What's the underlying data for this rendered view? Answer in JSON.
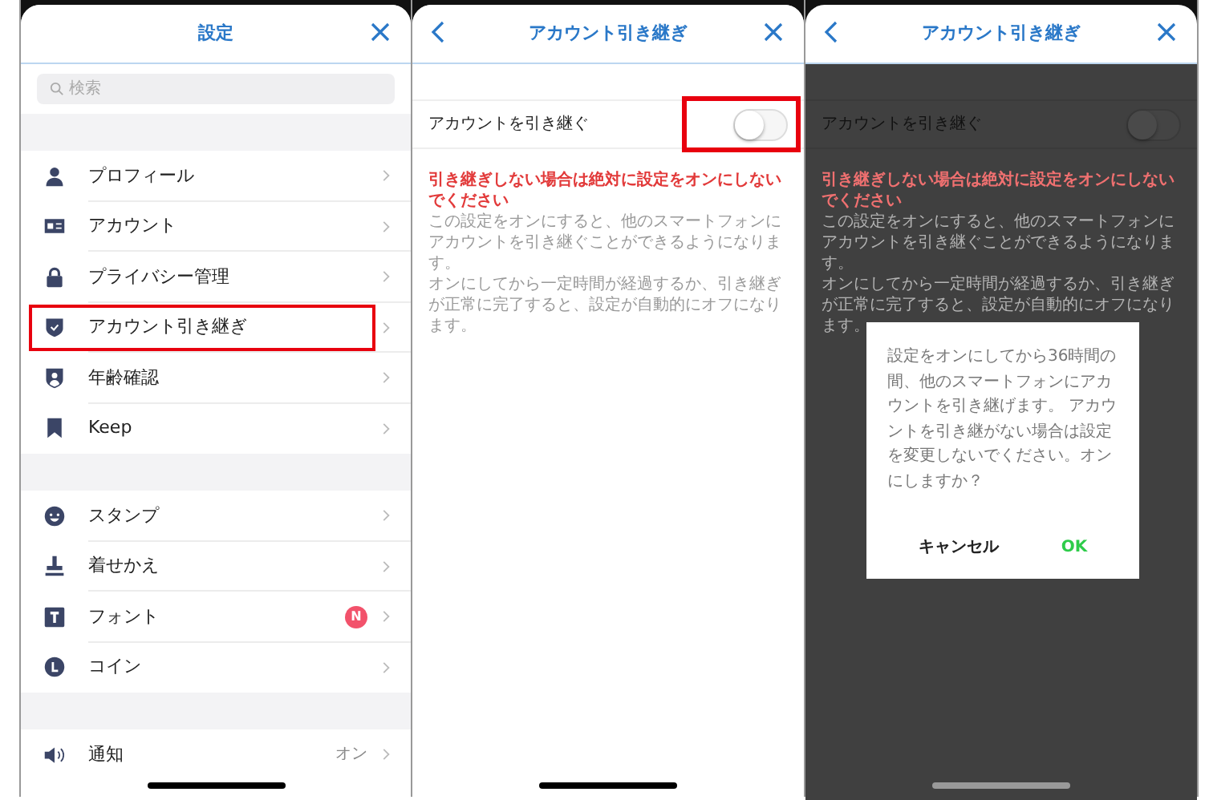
{
  "settings_screen": {
    "title": "設定",
    "search": {
      "placeholder": "検索"
    },
    "sections": [
      {
        "items": [
          {
            "label": "プロフィール",
            "highlighted": false
          },
          {
            "label": "アカウント",
            "highlighted": false
          },
          {
            "label": "プライバシー管理",
            "highlighted": false
          },
          {
            "label": "アカウント引き継ぎ",
            "highlighted": true
          },
          {
            "label": "年齢確認",
            "highlighted": false
          },
          {
            "label": "Keep",
            "highlighted": false
          }
        ]
      },
      {
        "items": [
          {
            "label": "スタンプ",
            "highlighted": false
          },
          {
            "label": "着せかえ",
            "highlighted": false
          },
          {
            "label": "フォント",
            "highlighted": false,
            "badge": "N"
          },
          {
            "label": "コイン",
            "highlighted": false
          }
        ]
      },
      {
        "items": [
          {
            "label": "通知",
            "highlighted": false,
            "value": "オン"
          }
        ]
      }
    ]
  },
  "transfer_screen": {
    "title": "アカウント引き継ぎ",
    "toggle": {
      "label": "アカウントを引き継ぐ",
      "on": false,
      "highlighted": true
    },
    "warning": "引き継ぎしない場合は絶対に設定をオンにしないでください",
    "description": [
      "この設定をオンにすると、他のスマートフォンにアカウントを引き継ぐことができるようになります。",
      "オンにしてから一定時間が経過するか、引き継ぎが正常に完了すると、設定が自動的にオフになります。"
    ]
  },
  "confirm_screen": {
    "title": "アカウント引き継ぎ",
    "toggle": {
      "label": "アカウントを引き継ぐ",
      "on": false
    },
    "warning": "引き継ぎしない場合は絶対に設定をオンにしないでください",
    "description": [
      "この設定をオンにすると、他のスマートフォンにアカウントを引き継ぐことができるようになります。",
      "オンにしてから一定時間が経過するか、引き継ぎが正常に完了すると、設定が自動的にオフになります。"
    ],
    "dialog": {
      "message": "設定をオンにしてから36時間の間、他のスマートフォンにアカウントを引き継げます。 アカウントを引き継がない場合は設定を変更しないでください。オンにしますか？",
      "buttons": [
        {
          "label": "キャンセル",
          "kind": "cancel"
        },
        {
          "label": "OK",
          "kind": "confirm"
        }
      ]
    }
  }
}
